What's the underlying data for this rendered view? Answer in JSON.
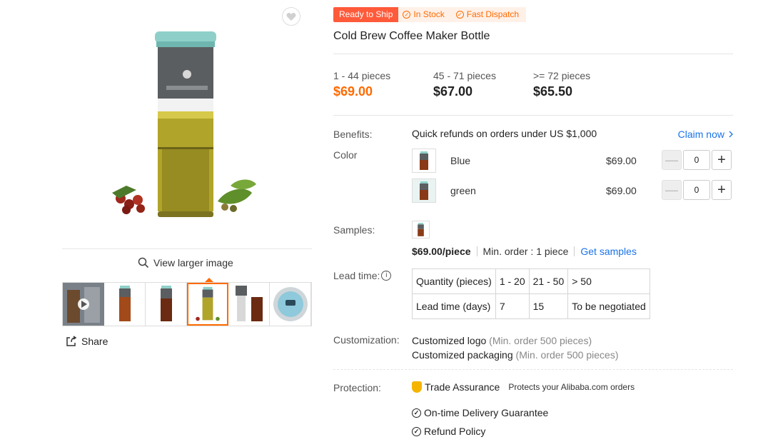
{
  "gallery": {
    "view_larger": "View larger image",
    "share": "Share",
    "thumbnails": [
      "video",
      "bottle-brown",
      "bottle-dark",
      "bottle-green",
      "bottle-pour",
      "device-top"
    ],
    "selected_thumbnail": 3
  },
  "badges": {
    "ready": "Ready to Ship",
    "in_stock": "In Stock",
    "fast_dispatch": "Fast Dispatch"
  },
  "product": {
    "title": "Cold Brew Coffee Maker Bottle"
  },
  "price_tiers": [
    {
      "qty": "1 - 44 pieces",
      "price": "$69.00"
    },
    {
      "qty": "45 - 71 pieces",
      "price": "$67.00"
    },
    {
      "qty": ">= 72 pieces",
      "price": "$65.50"
    }
  ],
  "benefits": {
    "label": "Benefits:",
    "text": "Quick refunds on orders under US $1,000",
    "claim": "Claim now"
  },
  "color": {
    "label": "Color",
    "options": [
      {
        "name": "Blue",
        "price": "$69.00",
        "quantity": "0"
      },
      {
        "name": "green",
        "price": "$69.00",
        "quantity": "0"
      }
    ]
  },
  "samples": {
    "label": "Samples:",
    "price": "$69.00/piece",
    "min_order": "Min. order : 1 piece",
    "link": "Get samples"
  },
  "lead_time": {
    "label": "Lead time:",
    "rows": [
      [
        "Quantity (pieces)",
        "1 - 20",
        "21 - 50",
        "> 50"
      ],
      [
        "Lead time (days)",
        "7",
        "15",
        "To be negotiated"
      ]
    ]
  },
  "customization": {
    "label": "Customization:",
    "items": [
      {
        "name": "Customized logo",
        "note": "(Min. order 500 pieces)"
      },
      {
        "name": "Customized packaging",
        "note": "(Min. order 500 pieces)"
      }
    ]
  },
  "protection": {
    "label": "Protection:",
    "trade_assurance": "Trade Assurance",
    "trade_desc": "Protects your Alibaba.com orders",
    "items": [
      "On-time Delivery Guarantee",
      "Refund Policy"
    ]
  },
  "colors": {
    "accent": "#ff6a00",
    "link": "#1a73e8",
    "badge_red": "#ff5a3a"
  }
}
